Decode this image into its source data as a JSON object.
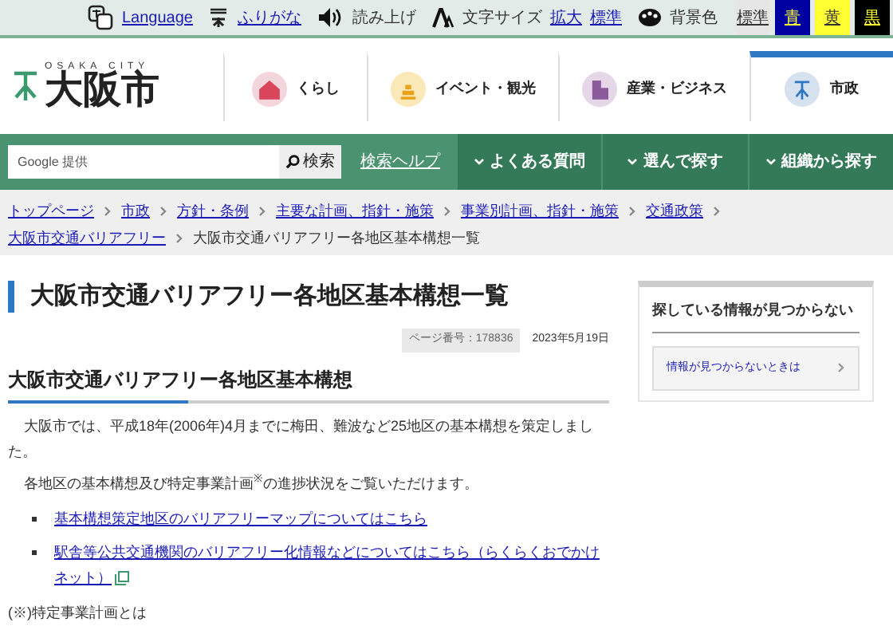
{
  "utility_bar": {
    "items": [
      {
        "kind": "link",
        "label": "Language"
      },
      {
        "kind": "link",
        "label": "ふりがな"
      },
      {
        "kind": "text",
        "label": "読み上げ"
      }
    ],
    "font_size": {
      "label": "文字サイズ",
      "options": [
        "拡大",
        "標準"
      ]
    },
    "background": {
      "label": "背景色",
      "options": [
        {
          "label": "標準",
          "color": "#e6e6e6"
        },
        {
          "label": "青",
          "color": "#0000a0"
        },
        {
          "label": "黄",
          "color": "#ffff33"
        },
        {
          "label": "黒",
          "color": "#000000"
        }
      ]
    }
  },
  "logo": {
    "tagline": "OSAKA CITY",
    "name": "大阪市"
  },
  "main_nav": [
    {
      "label": "くらし",
      "color": "#f3d6dc",
      "selected": false
    },
    {
      "label": "イベント・観光",
      "color": "#fbe8b8",
      "selected": false
    },
    {
      "label": "産業・ビジネス",
      "color": "#e5d6e8",
      "selected": false
    },
    {
      "label": "市政",
      "color": "#d6e2f0",
      "selected": true
    }
  ],
  "search": {
    "placeholder": "Google 提供",
    "button": "検索",
    "help": "検索ヘルプ"
  },
  "menu": [
    "よくある質問",
    "選んで探す",
    "組織から探す"
  ],
  "breadcrumb": {
    "links": [
      "トップページ",
      "市政",
      "方針・条例",
      "主要な計画、指針・施策",
      "事業別計画、指針・施策",
      "交通政策",
      "大阪市交通バリアフリー"
    ],
    "current": "大阪市交通バリアフリー各地区基本構想一覧"
  },
  "page": {
    "title": "大阪市交通バリアフリー各地区基本構想一覧",
    "page_number": "ページ番号：178836",
    "date": "2023年5月19日",
    "section_heading": "大阪市交通バリアフリー各地区基本構想",
    "paragraphs": [
      "大阪市では、平成18年(2006年)4月までに梅田、難波など25地区の基本構想を策定しました。",
      "各地区の基本構想及び特定事業計画$^{※}$の進捗状況をご覧いただけます。"
    ],
    "links": [
      {
        "label": "基本構想策定地区のバリアフリーマップについてはこちら",
        "external": false
      },
      {
        "label": "駅舎等公共交通機関のバリアフリー化情報などについてはこちら（らくらくおでかけネット）",
        "external": true
      }
    ],
    "note": "(※)特定事業計画とは"
  },
  "sidebar": {
    "heading": "探している情報が見つからない",
    "link": "情報が見つからないときは"
  }
}
